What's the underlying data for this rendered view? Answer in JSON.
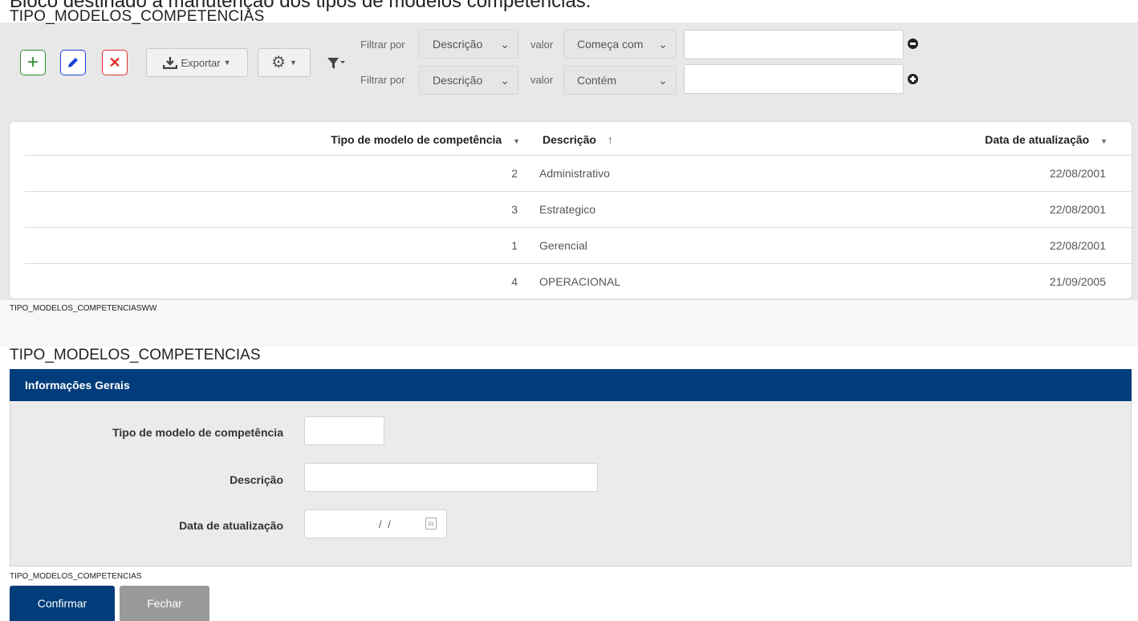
{
  "page": {
    "top_caption": "Bloco destinado à manutenção dos tipos de modelos competências."
  },
  "list": {
    "title": "TIPO_MODELOS_COMPETENCIAS",
    "footer": "TIPO_MODELOS_COMPETENCIASWW",
    "toolbar": {
      "export_label": "Exportar"
    },
    "filters": [
      {
        "prefix": "Filtrar por",
        "field": "Descrição",
        "value_label": "valor",
        "operator": "Começa com",
        "text": "",
        "action_icon": "minus-circle-icon"
      },
      {
        "prefix": "Filtrar por",
        "field": "Descrição",
        "value_label": "valor",
        "operator": "Contém",
        "text": "",
        "action_icon": "plus-circle-icon"
      }
    ],
    "columns": [
      "Tipo de modelo de competência",
      "Descrição",
      "Data de atualização"
    ],
    "sort": {
      "Descrição": "ascending"
    },
    "rows": [
      {
        "tipo": "2",
        "descricao": "Administrativo",
        "data": "22/08/2001"
      },
      {
        "tipo": "3",
        "descricao": "Estrategico",
        "data": "22/08/2001"
      },
      {
        "tipo": "1",
        "descricao": "Gerencial",
        "data": "22/08/2001"
      },
      {
        "tipo": "4",
        "descricao": "OPERACIONAL",
        "data": "21/09/2005"
      }
    ]
  },
  "form": {
    "title": "TIPO_MODELOS_COMPETENCIAS",
    "section": "Informações Gerais",
    "fields": {
      "tipo_label": "Tipo de modelo de competência",
      "tipo_value": "",
      "descricao_label": "Descrição",
      "descricao_value": "",
      "data_label": "Data de atualização",
      "data_value": "/ /"
    },
    "footer": "TIPO_MODELOS_COMPETENCIAS",
    "confirm_label": "Confirmar",
    "close_label": "Fechar"
  },
  "colors": {
    "add": "#2e8b2e",
    "edit": "#1a3fd9",
    "delete": "#e03030",
    "form_header": "#003d7a",
    "confirm": "#003d7a",
    "close": "#999999"
  }
}
